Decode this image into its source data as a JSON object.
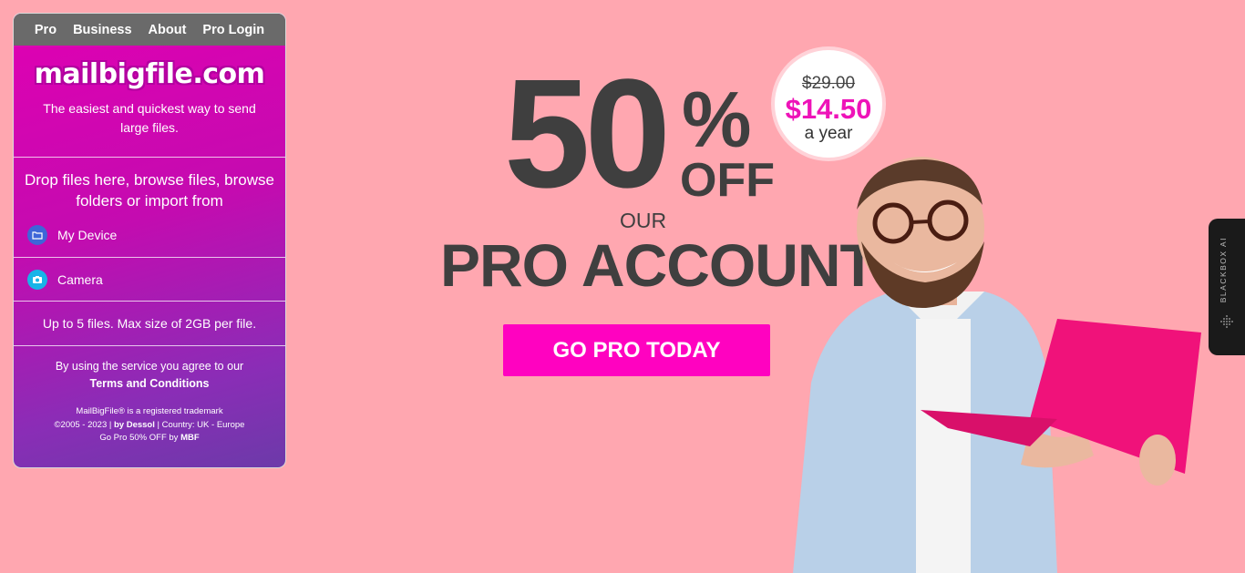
{
  "nav": {
    "items": [
      "Pro",
      "Business",
      "About",
      "Pro Login"
    ]
  },
  "brand": {
    "logo": "mailbigfile.com",
    "tagline": "The easiest and quickest way to send large files."
  },
  "upload": {
    "drop_text": "Drop files here, browse files, browse folders or import from",
    "sources": [
      {
        "label": "My Device",
        "icon": "folder-icon"
      },
      {
        "label": "Camera",
        "icon": "camera-icon"
      }
    ],
    "limits": "Up to 5 files. Max size of 2GB per file."
  },
  "terms": {
    "text": "By using the service you agree to our",
    "link": "Terms and Conditions"
  },
  "footer": {
    "trademark": "MailBigFile® is a registered trademark",
    "copyright_prefix": "©2005 - 2023 |",
    "by": "by Dessol",
    "country": "| Country: UK - Europe",
    "promo_prefix": "Go Pro 50% OFF by",
    "promo_brand": "MBF"
  },
  "hero": {
    "big_number": "50",
    "percent": "%",
    "off": "OFF",
    "our": "OUR",
    "headline": "PRO ACCOUNT",
    "cta": "GO PRO TODAY"
  },
  "price_badge": {
    "old_price": "$29.00",
    "new_price": "$14.50",
    "period": "a year"
  },
  "side_tab": {
    "label": "BLACKBOX AI"
  },
  "colors": {
    "background": "#ffa7b0",
    "accent": "#ff02c0",
    "panel_top": "#e000b2",
    "panel_bottom": "#6c3aa9",
    "nav_bg": "#6a6a6a",
    "text_dark": "#3f3f3f"
  }
}
